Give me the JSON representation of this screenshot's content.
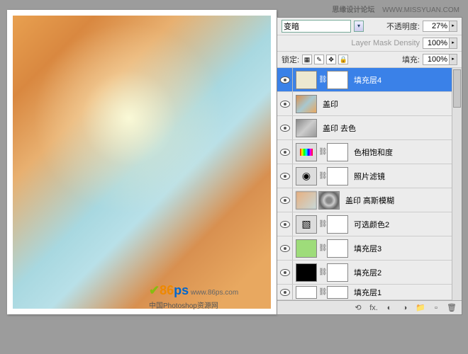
{
  "watermark": {
    "brand": "思缘设计论坛",
    "url": "WWW.MISSYUAN.COM"
  },
  "logo": {
    "psLabel": "86",
    "psSuffix": "ps",
    "url": "www.86ps.com",
    "sub": "中国Photoshop资源网"
  },
  "panel": {
    "blendMode": "变暗",
    "opacityLabel": "不透明度:",
    "opacityValue": "27%",
    "maskDensityLabel": "Layer Mask Density",
    "maskDensityValue": "100%",
    "lockLabel": "锁定:",
    "fillLabel": "填充:",
    "fillValue": "100%"
  },
  "layers": [
    {
      "name": "填充层4",
      "selected": true
    },
    {
      "name": "盖印"
    },
    {
      "name": "盖印 去色"
    },
    {
      "name": "色相饱和度"
    },
    {
      "name": "照片滤镜"
    },
    {
      "name": "盖印 高斯模糊"
    },
    {
      "name": "可选颜色2"
    },
    {
      "name": "填充层3"
    },
    {
      "name": "填充层2"
    },
    {
      "name": "填充层1"
    }
  ],
  "footerIcons": {
    "link": "⟲",
    "fx": "fx.",
    "mask": "◐",
    "adj": "◑",
    "folder": "📁",
    "new": "▫",
    "trash": "🗑"
  }
}
